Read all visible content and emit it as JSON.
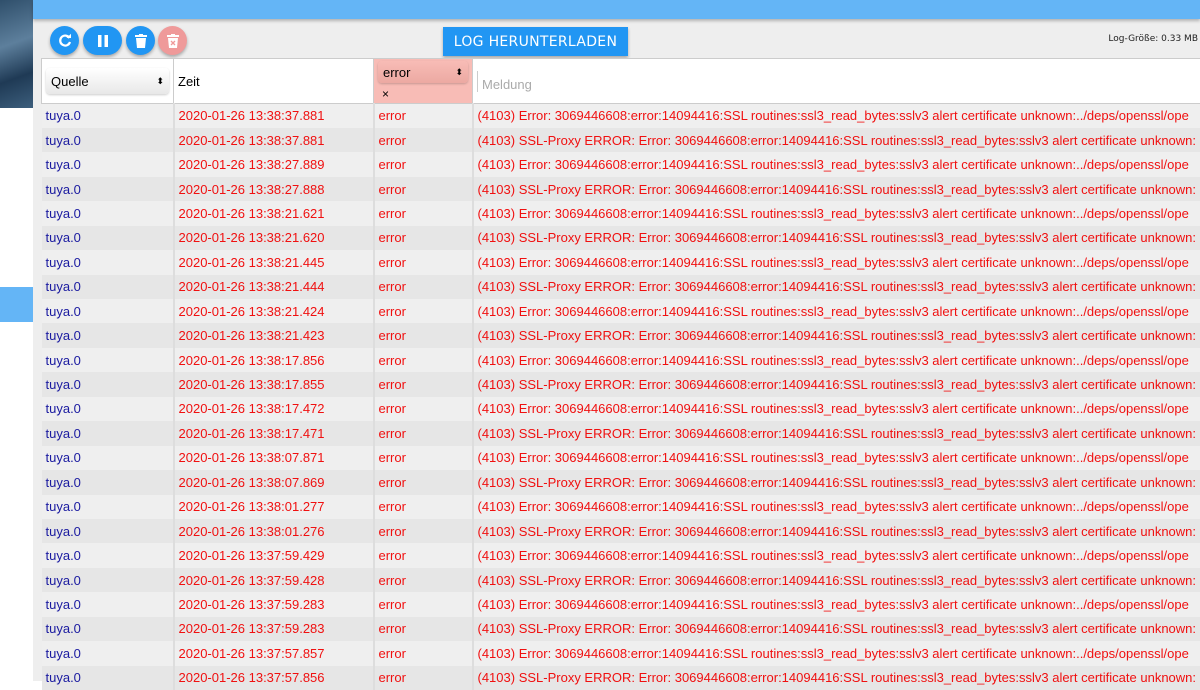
{
  "toolbar": {
    "download_label": "LOG HERUNTERLADEN",
    "log_size": "Log-Größe: 0.33 MB"
  },
  "header": {
    "source_select": "Quelle",
    "time": "Zeit",
    "level_select": "error",
    "level_clear": "×",
    "message_placeholder": "Meldung"
  },
  "colors": {
    "accent": "#2196f3",
    "error": "#f01010",
    "source": "#1a1aa0"
  },
  "messages": {
    "a": "(4103) Error: 3069446608:error:14094416:SSL routines:ssl3_read_bytes:sslv3 alert certificate unknown:../deps/openssl/ope",
    "b": "(4103) SSL-Proxy ERROR: Error: 3069446608:error:14094416:SSL routines:ssl3_read_bytes:sslv3 alert certificate unknown:"
  },
  "rows": [
    {
      "source": "tuya.0",
      "time": "2020-01-26 13:38:37.881",
      "level": "error",
      "msg": "a"
    },
    {
      "source": "tuya.0",
      "time": "2020-01-26 13:38:37.881",
      "level": "error",
      "msg": "b"
    },
    {
      "source": "tuya.0",
      "time": "2020-01-26 13:38:27.889",
      "level": "error",
      "msg": "a"
    },
    {
      "source": "tuya.0",
      "time": "2020-01-26 13:38:27.888",
      "level": "error",
      "msg": "b"
    },
    {
      "source": "tuya.0",
      "time": "2020-01-26 13:38:21.621",
      "level": "error",
      "msg": "a"
    },
    {
      "source": "tuya.0",
      "time": "2020-01-26 13:38:21.620",
      "level": "error",
      "msg": "b"
    },
    {
      "source": "tuya.0",
      "time": "2020-01-26 13:38:21.445",
      "level": "error",
      "msg": "a"
    },
    {
      "source": "tuya.0",
      "time": "2020-01-26 13:38:21.444",
      "level": "error",
      "msg": "b"
    },
    {
      "source": "tuya.0",
      "time": "2020-01-26 13:38:21.424",
      "level": "error",
      "msg": "a"
    },
    {
      "source": "tuya.0",
      "time": "2020-01-26 13:38:21.423",
      "level": "error",
      "msg": "b"
    },
    {
      "source": "tuya.0",
      "time": "2020-01-26 13:38:17.856",
      "level": "error",
      "msg": "a"
    },
    {
      "source": "tuya.0",
      "time": "2020-01-26 13:38:17.855",
      "level": "error",
      "msg": "b"
    },
    {
      "source": "tuya.0",
      "time": "2020-01-26 13:38:17.472",
      "level": "error",
      "msg": "a"
    },
    {
      "source": "tuya.0",
      "time": "2020-01-26 13:38:17.471",
      "level": "error",
      "msg": "b"
    },
    {
      "source": "tuya.0",
      "time": "2020-01-26 13:38:07.871",
      "level": "error",
      "msg": "a"
    },
    {
      "source": "tuya.0",
      "time": "2020-01-26 13:38:07.869",
      "level": "error",
      "msg": "b"
    },
    {
      "source": "tuya.0",
      "time": "2020-01-26 13:38:01.277",
      "level": "error",
      "msg": "a"
    },
    {
      "source": "tuya.0",
      "time": "2020-01-26 13:38:01.276",
      "level": "error",
      "msg": "b"
    },
    {
      "source": "tuya.0",
      "time": "2020-01-26 13:37:59.429",
      "level": "error",
      "msg": "a"
    },
    {
      "source": "tuya.0",
      "time": "2020-01-26 13:37:59.428",
      "level": "error",
      "msg": "b"
    },
    {
      "source": "tuya.0",
      "time": "2020-01-26 13:37:59.283",
      "level": "error",
      "msg": "a"
    },
    {
      "source": "tuya.0",
      "time": "2020-01-26 13:37:59.283",
      "level": "error",
      "msg": "b"
    },
    {
      "source": "tuya.0",
      "time": "2020-01-26 13:37:57.857",
      "level": "error",
      "msg": "a"
    },
    {
      "source": "tuya.0",
      "time": "2020-01-26 13:37:57.856",
      "level": "error",
      "msg": "b"
    }
  ]
}
